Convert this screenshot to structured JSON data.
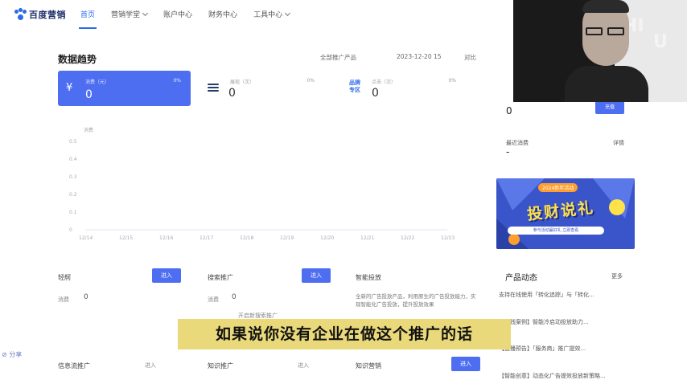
{
  "header": {
    "logo": "百度营销",
    "nav": [
      {
        "label": "首页",
        "active": true,
        "caret": false
      },
      {
        "label": "营销学堂",
        "active": false,
        "caret": true
      },
      {
        "label": "账户中心",
        "active": false,
        "caret": false
      },
      {
        "label": "财务中心",
        "active": false,
        "caret": false
      },
      {
        "label": "工具中心",
        "active": false,
        "caret": true
      }
    ]
  },
  "trend": {
    "title": "数据趋势",
    "product_filter": "全部推广产品",
    "date": "2023-12-20 15",
    "compare": "对比",
    "cards": [
      {
        "label": "消费（元）",
        "value": "0",
        "pct": "0%"
      },
      {
        "label": "展现（次）",
        "value": "0",
        "pct": "0%"
      },
      {
        "label": "点击（次）",
        "value": "0",
        "pct": "0%"
      }
    ],
    "brand_icon_text": "品牌专区"
  },
  "chart_data": {
    "type": "line",
    "title": "",
    "ylabel": "消费",
    "xlabel": "",
    "y_ticks": [
      "0.5",
      "0.4",
      "0.3",
      "0.2",
      "0.1",
      "0"
    ],
    "x_ticks": [
      "12/14",
      "12/15",
      "12/16",
      "12/17",
      "12/18",
      "12/19",
      "12/20",
      "12/21",
      "12/22",
      "12/23"
    ],
    "series": [
      {
        "values": [
          0,
          0,
          0,
          0,
          0,
          0,
          0,
          0,
          0,
          0
        ]
      }
    ],
    "ylim": [
      0,
      0.5
    ],
    "grid": false
  },
  "products": [
    {
      "title": "轻舸",
      "button": "进入",
      "value_label": "消费",
      "value": "0"
    },
    {
      "title": "搜索推广",
      "button": "进入",
      "value_label": "消费",
      "value": "0",
      "note": "开启新搜索推广"
    },
    {
      "title": "智能投放",
      "desc": "全新的广告投放产品，利用原生的广告投放能力，实现智能化广告投放，提升投放效果"
    },
    {
      "title": "信息流推广",
      "button_text": "进入"
    },
    {
      "title": "知识推广",
      "button_text": "进入"
    },
    {
      "title": "知识营销",
      "button": "进入"
    }
  ],
  "right": {
    "balance_value": "0",
    "balance_button": "充值",
    "second_label": "最近消费",
    "second_link": "详情",
    "second_value": "-",
    "banner": {
      "top": "2024新年活动",
      "main": "投财说礼",
      "strip": "参与活动赢好礼 立即查看"
    },
    "product_news_title": "产品动态",
    "product_news_more": "更多",
    "news": [
      "支持在线使用「转化追踪」与「转化...",
      "【实践案例】智能冷启动投放助力...",
      "【直播预告】「服务商」推广提效...",
      "【智能创意】动态化广告提效投放新策略..."
    ]
  },
  "subtitle": "如果说你没有企业在做这个推广的话",
  "share": "⊘ 分享"
}
